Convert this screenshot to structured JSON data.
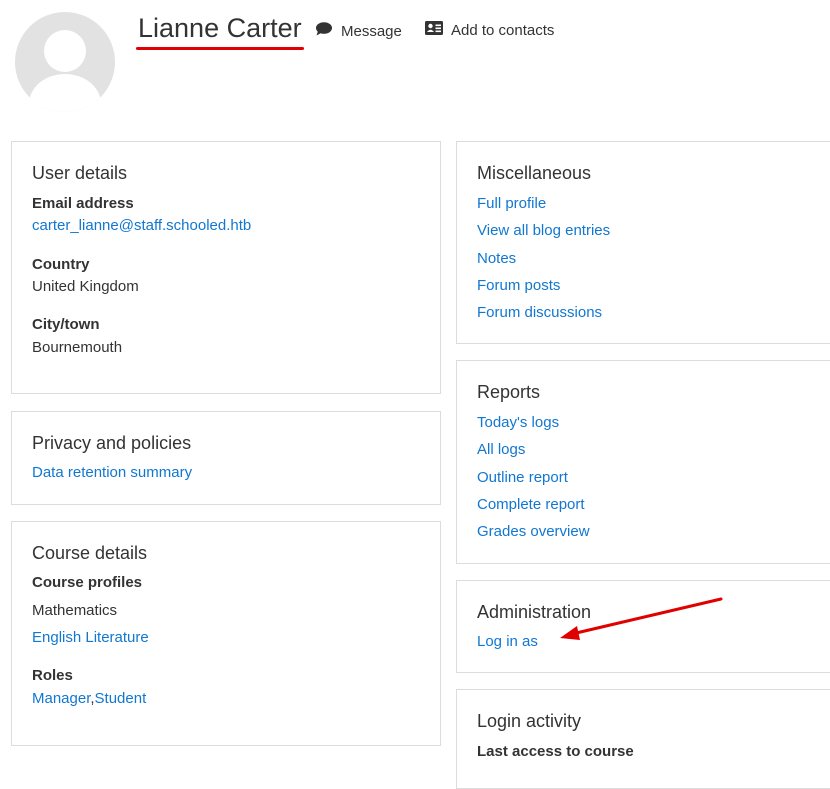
{
  "header": {
    "name": "Lianne Carter",
    "message_label": "Message",
    "contacts_label": "Add to contacts"
  },
  "user_details": {
    "title": "User details",
    "email_label": "Email address",
    "email_value": "carter_lianne@staff.schooled.htb",
    "country_label": "Country",
    "country_value": "United Kingdom",
    "city_label": "City/town",
    "city_value": "Bournemouth"
  },
  "privacy": {
    "title": "Privacy and policies",
    "link": "Data retention summary"
  },
  "course_details": {
    "title": "Course details",
    "profiles_label": "Course profiles",
    "courses": [
      "Mathematics",
      "English Literature"
    ],
    "roles_label": "Roles",
    "role_manager": "Manager",
    "role_separator": ",",
    "role_student": "Student"
  },
  "miscellaneous": {
    "title": "Miscellaneous",
    "links": [
      "Full profile",
      "View all blog entries",
      "Notes",
      "Forum posts",
      "Forum discussions"
    ]
  },
  "reports": {
    "title": "Reports",
    "links": [
      "Today's logs",
      "All logs",
      "Outline report",
      "Complete report",
      "Grades overview"
    ]
  },
  "administration": {
    "title": "Administration",
    "link": "Log in as"
  },
  "login_activity": {
    "title": "Login activity",
    "last_access_label": "Last access to course"
  },
  "colors": {
    "link": "#1177d1",
    "annotation": "#e00000",
    "border": "#dcdcdc"
  }
}
